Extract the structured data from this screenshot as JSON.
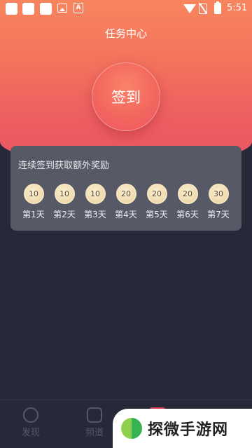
{
  "status_bar": {
    "time": "5:51",
    "badge_a": "A"
  },
  "header": {
    "title": "任务中心"
  },
  "sign_in": {
    "label": "签到"
  },
  "reward_card": {
    "title": "连续签到获取额外奖励",
    "days": [
      {
        "coins": "10",
        "label": "第1天"
      },
      {
        "coins": "10",
        "label": "第2天"
      },
      {
        "coins": "10",
        "label": "第3天"
      },
      {
        "coins": "20",
        "label": "第4天"
      },
      {
        "coins": "20",
        "label": "第5天"
      },
      {
        "coins": "20",
        "label": "第6天"
      },
      {
        "coins": "30",
        "label": "第7天"
      }
    ]
  },
  "bottom_nav": {
    "items": [
      {
        "label": "发现",
        "icon": "compass-icon"
      },
      {
        "label": "频道",
        "icon": "play-icon"
      }
    ]
  },
  "watermark": {
    "text": "探微手游网"
  },
  "colors": {
    "accent": "#ef5a62",
    "background": "#262a38",
    "card": "#575a66",
    "coin": "#f0deb2"
  }
}
